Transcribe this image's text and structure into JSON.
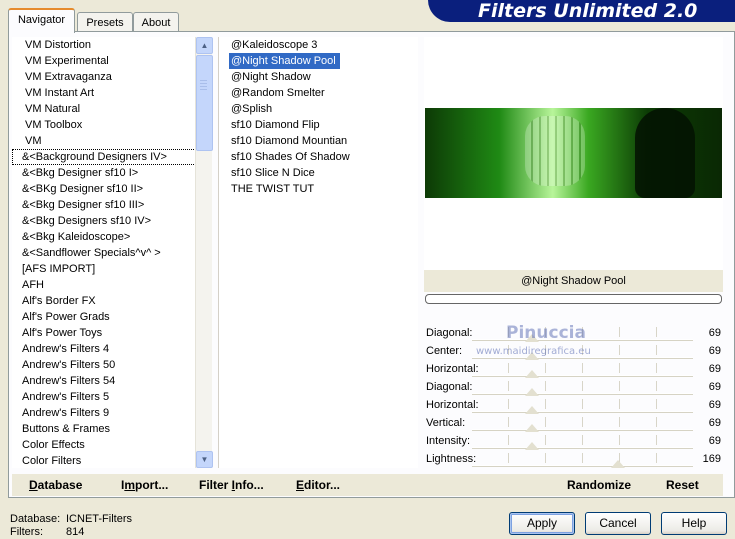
{
  "app_title": "Filters Unlimited 2.0",
  "tabs": [
    {
      "label": "Navigator",
      "active": true
    },
    {
      "label": "Presets",
      "active": false
    },
    {
      "label": "About",
      "active": false
    }
  ],
  "categories": [
    "VM Distortion",
    "VM Experimental",
    "VM Extravaganza",
    "VM Instant Art",
    "VM Natural",
    "VM Toolbox",
    "VM",
    "&<Background Designers IV>",
    "&<Bkg Designer sf10 I>",
    "&<BKg Designer sf10 II>",
    "&<Bkg Designer sf10 III>",
    "&<Bkg Designers sf10 IV>",
    "&<Bkg Kaleidoscope>",
    "&<Sandflower Specials^v^ >",
    "[AFS IMPORT]",
    "AFH",
    "Alf's Border FX",
    "Alf's Power Grads",
    "Alf's Power Toys",
    "Andrew's Filters 4",
    "Andrew's Filters 50",
    "Andrew's Filters 54",
    "Andrew's Filters 5",
    "Andrew's Filters 9",
    "Buttons & Frames",
    "Color Effects",
    "Color Filters"
  ],
  "filters": [
    "@Kaleidoscope 3",
    "@Night Shadow Pool",
    "@Night Shadow",
    "@Random Smelter",
    "@Splish",
    "sf10 Diamond Flip",
    "sf10 Diamond Mountian",
    "sf10 Shades Of Shadow",
    "sf10 Slice N Dice",
    "THE TWIST TUT"
  ],
  "selected_filter": "@Night Shadow Pool",
  "sliders": [
    {
      "label": "Diagonal:",
      "value": "69",
      "level": 0.27
    },
    {
      "label": "Center:",
      "value": "69",
      "level": 0.27
    },
    {
      "label": "Horizontal:",
      "value": "69",
      "level": 0.27
    },
    {
      "label": "Diagonal:",
      "value": "69",
      "level": 0.27
    },
    {
      "label": "Horizontal:",
      "value": "69",
      "level": 0.27
    },
    {
      "label": "Vertical:",
      "value": "69",
      "level": 0.27
    },
    {
      "label": "Intensity:",
      "value": "69",
      "level": 0.27
    },
    {
      "label": "Lightness:",
      "value": "169",
      "level": 0.66
    }
  ],
  "watermark": {
    "name": "Pinuccia",
    "url": "www.maidiregrafica.eu"
  },
  "bottom_links": {
    "database": {
      "u": "D",
      "rest": "atabase"
    },
    "import": {
      "pre": "I",
      "u": "m",
      "rest": "port..."
    },
    "filter_info": {
      "pre": "Filter ",
      "u": "I",
      "rest": "nfo..."
    },
    "editor": {
      "u": "E",
      "rest": "ditor..."
    },
    "randomize": "Randomize",
    "reset": "Reset"
  },
  "info": {
    "database_label": "Database:",
    "database_value": "ICNET-Filters",
    "filters_label": "Filters:",
    "filters_value": "814"
  },
  "buttons": {
    "apply": "Apply",
    "cancel": "Cancel",
    "help": "Help"
  }
}
